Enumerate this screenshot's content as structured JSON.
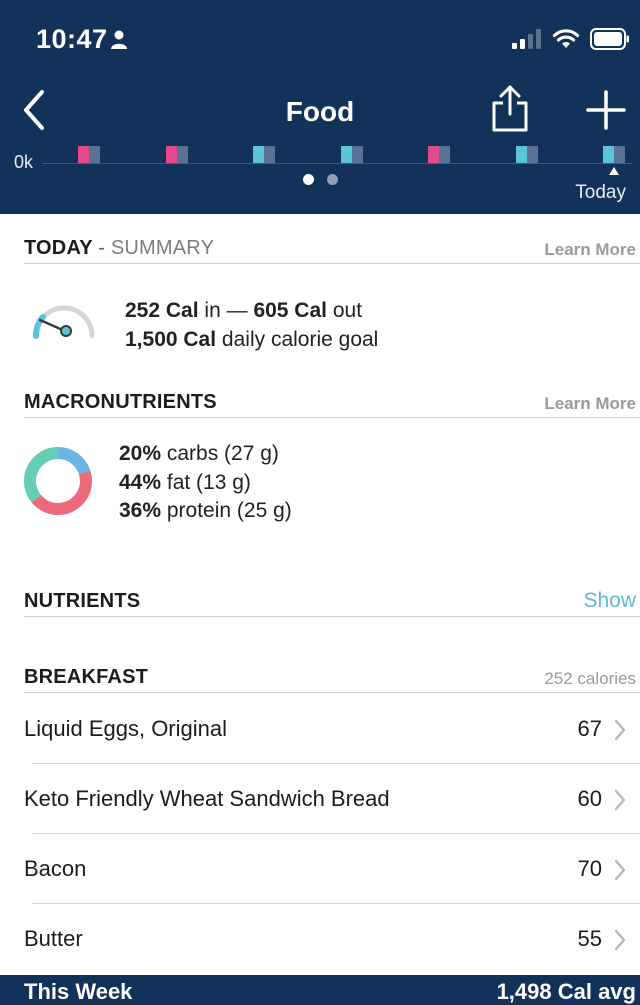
{
  "status_bar": {
    "time": "10:47",
    "icons": [
      "person-icon",
      "signal-icon",
      "wifi-icon",
      "battery-icon"
    ]
  },
  "nav": {
    "title": "Food",
    "back_icon": "chevron-left-icon",
    "share_icon": "share-icon",
    "add_icon": "plus-icon"
  },
  "chart": {
    "axis_label": "0k",
    "today_label": "Today",
    "days": [
      {
        "color": "#e24a8d"
      },
      {
        "color": "#e24a8d"
      },
      {
        "color": "#5cc4d8"
      },
      {
        "color": "#5cc4d8"
      },
      {
        "color": "#e24a8d"
      },
      {
        "color": "#5cc4d8"
      },
      {
        "color": "#5cc4d8"
      }
    ],
    "page_count": 2,
    "active_page": 0
  },
  "summary": {
    "title": "TODAY",
    "separator": "-",
    "subtitle": "SUMMARY",
    "learn_more": "Learn More",
    "cal_in": "252 Cal",
    "in_text": "in —",
    "cal_out": "605 Cal",
    "out_text": "out",
    "goal": "1,500 Cal",
    "goal_text": "daily calorie goal"
  },
  "macros": {
    "title": "MACRONUTRIENTS",
    "learn_more": "Learn More",
    "items": [
      {
        "pct": "20%",
        "label": "carbs (27 g)",
        "value": 20,
        "color": "#6cb4e4"
      },
      {
        "pct": "44%",
        "label": "fat (13 g)",
        "value": 44,
        "color": "#ec6a7c"
      },
      {
        "pct": "36%",
        "label": "protein (25 g)",
        "value": 36,
        "color": "#66cdb7"
      }
    ]
  },
  "nutrients": {
    "title": "NUTRIENTS",
    "show": "Show"
  },
  "breakfast": {
    "title": "BREAKFAST",
    "calories": "252 calories",
    "items": [
      {
        "name": "Liquid Eggs, Original",
        "value": "67"
      },
      {
        "name": "Keto Friendly Wheat Sandwich Bread",
        "value": "60"
      },
      {
        "name": "Bacon",
        "value": "70"
      },
      {
        "name": "Butter",
        "value": "55"
      }
    ]
  },
  "footer": {
    "left": "This Week",
    "right": "1,498 Cal avg"
  },
  "colors": {
    "header_bg": "#13325a",
    "accent_link": "#5fb8d6",
    "gauge_teal": "#5cc4d8"
  }
}
